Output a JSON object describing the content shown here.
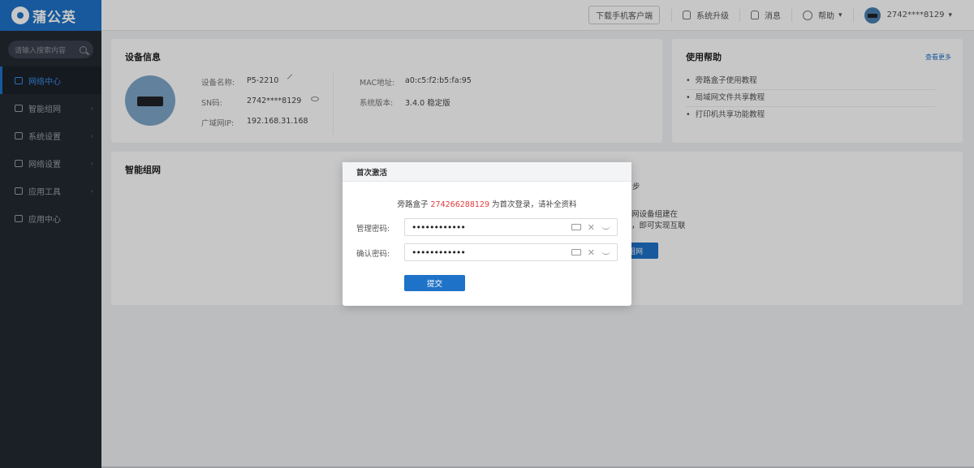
{
  "app": {
    "logo_text": "蒲公英"
  },
  "sidebar": {
    "search_placeholder": "请输入搜索内容",
    "items": [
      {
        "label": "网络中心",
        "active": true
      },
      {
        "label": "智能组网"
      },
      {
        "label": "系统设置"
      },
      {
        "label": "网络设置"
      },
      {
        "label": "应用工具"
      },
      {
        "label": "应用中心"
      }
    ]
  },
  "topbar": {
    "download_label": "下载手机客户端",
    "upgrade_label": "系统升级",
    "message_label": "消息",
    "help_label": "帮助",
    "help_chevron": "▾",
    "user_label": "2742****8129",
    "user_chevron": "▾"
  },
  "device_info": {
    "title": "设备信息",
    "name_key": "设备名称:",
    "name_val": "P5-2210",
    "sn_key": "SN码:",
    "sn_val": "2742****8129",
    "wan_key": "广域网IP:",
    "wan_val": "192.168.31.168",
    "mac_key": "MAC地址:",
    "mac_val": "a0:c5:f2:b5:fa:95",
    "ver_key": "系统版本:",
    "ver_val": "3.4.0 稳定版"
  },
  "help": {
    "title": "使用帮助",
    "more": "查看更多",
    "items": [
      "旁路盒子使用教程",
      "局域网文件共享教程",
      "打印机共享功能教程"
    ]
  },
  "smart_network": {
    "title": "智能组网",
    "frag_1": "步",
    "frag_2": "网设备组建在",
    "frag_3": "，即可实现互联",
    "frag_btn": "组网"
  },
  "modal": {
    "title": "首次激活",
    "msg_prefix": "旁路盒子 ",
    "msg_highlight": "274266288129",
    "msg_suffix": " 为首次登录，请补全资料",
    "pwd_label": "管理密码:",
    "pwd_value": "••••••••••••",
    "confirm_label": "确认密码:",
    "confirm_value": "••••••••••••",
    "clear_glyph": "✕",
    "submit_label": "提交"
  },
  "colors": {
    "brand": "#1e73c8",
    "sidebar_bg": "#232933",
    "highlight": "#e03a3a"
  }
}
